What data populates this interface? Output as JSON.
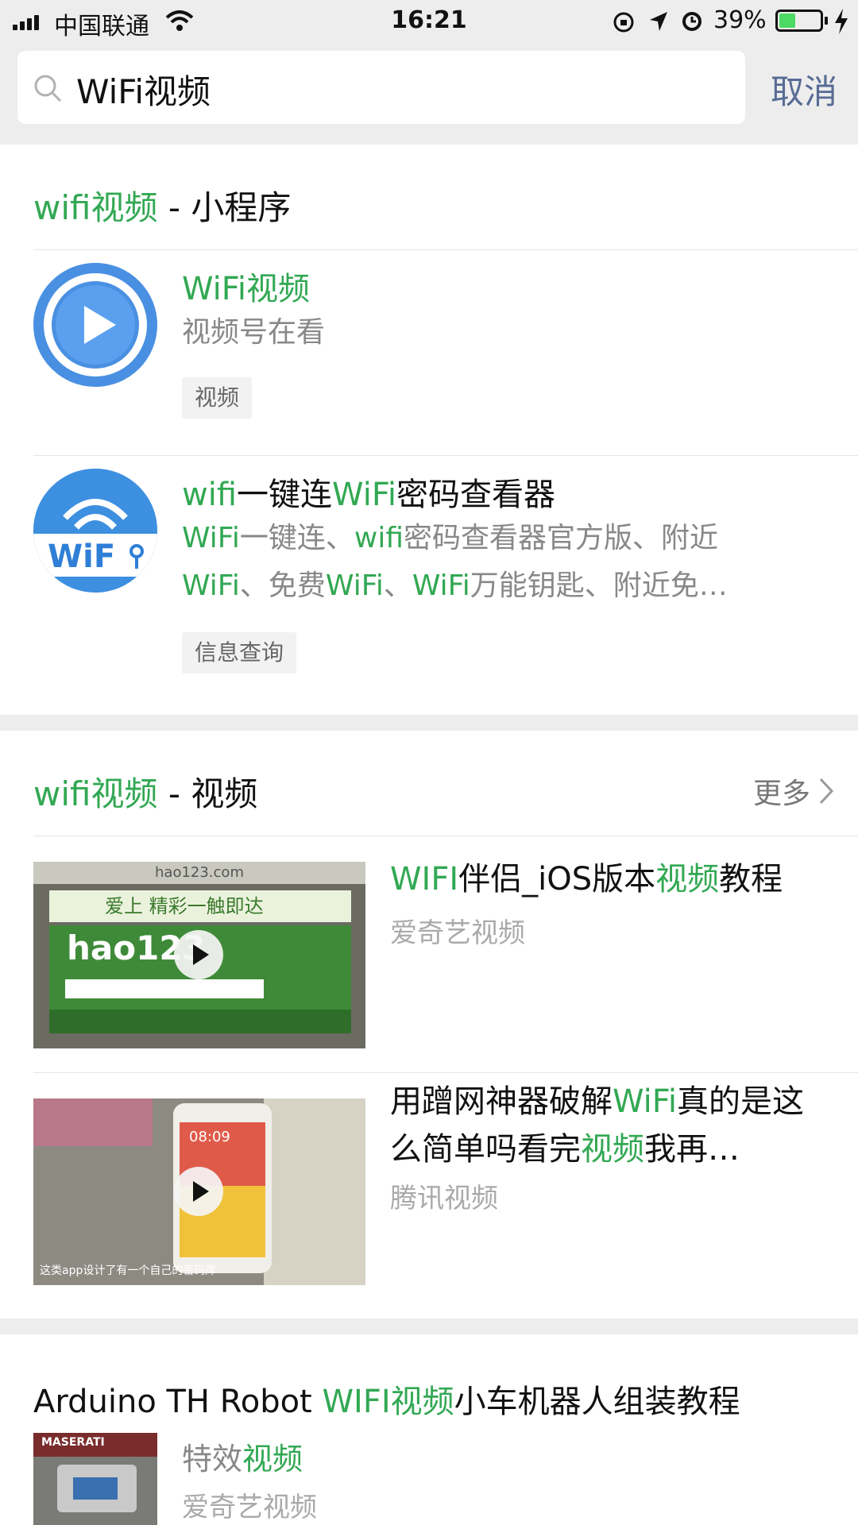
{
  "status_bar": {
    "carrier": "中国联通",
    "time": "16:21",
    "battery": "39%"
  },
  "search": {
    "query": "WiFi视频",
    "cancel_label": "取消"
  },
  "mini_program_section": {
    "title_highlight": "wifi视频",
    "title_rest": " - 小程序",
    "items": [
      {
        "title_parts": [
          {
            "text": "WiFi视频",
            "hl": true
          }
        ],
        "desc_lines": [
          [
            {
              "text": "视频号在看",
              "hl": false
            }
          ]
        ],
        "tag": "视频"
      },
      {
        "title_parts": [
          {
            "text": "wifi",
            "hl": true
          },
          {
            "text": "一键连",
            "hl": false
          },
          {
            "text": "WiFi",
            "hl": true
          },
          {
            "text": "密码查看器",
            "hl": false
          }
        ],
        "desc_lines": [
          [
            {
              "text": "WiFi",
              "hl": true
            },
            {
              "text": "一键连、",
              "hl": false
            },
            {
              "text": "wifi",
              "hl": true
            },
            {
              "text": "密码查看器官方版、附近",
              "hl": false
            }
          ],
          [
            {
              "text": "WiFi",
              "hl": true
            },
            {
              "text": "、免费",
              "hl": false
            },
            {
              "text": "WiFi",
              "hl": true
            },
            {
              "text": "、",
              "hl": false
            },
            {
              "text": "WiFi",
              "hl": true
            },
            {
              "text": "万能钥匙、附近免…",
              "hl": false
            }
          ]
        ],
        "tag": "信息查询",
        "icon_text": "WiF"
      }
    ]
  },
  "video_section": {
    "title_highlight": "wifi视频",
    "title_rest": " - 视频",
    "more_label": "更多",
    "items": [
      {
        "title_parts": [
          {
            "text": "WIFI",
            "hl": true
          },
          {
            "text": "伴侣_iOS版本",
            "hl": false
          },
          {
            "text": "视频",
            "hl": true
          },
          {
            "text": "教程",
            "hl": false
          }
        ],
        "source": "爱奇艺视频",
        "thumb_text_top": "hao123.com",
        "thumb_logo": "hao123",
        "thumb_banner": "爱上 精彩一触即达"
      },
      {
        "title_parts": [
          {
            "text": "用蹭网神器破解",
            "hl": false
          },
          {
            "text": "WiFi",
            "hl": true
          },
          {
            "text": "真的是这么简单吗看完",
            "hl": false
          },
          {
            "text": "视频",
            "hl": true
          },
          {
            "text": "我再…",
            "hl": false
          }
        ],
        "source": "腾讯视频",
        "thumb_time": "08:09",
        "thumb_caption": "这类app设计了有一个自己的密码库"
      }
    ]
  },
  "article": {
    "title_parts": [
      {
        "text": "Arduino TH Robot ",
        "hl": false
      },
      {
        "text": "WIFI视频",
        "hl": true
      },
      {
        "text": "小车机器人组装教程",
        "hl": false
      }
    ],
    "desc_parts": [
      {
        "text": "特效",
        "hl": false
      },
      {
        "text": "视频",
        "hl": true
      }
    ],
    "source": "爱奇艺视频",
    "thumb_brand": "MASERATI"
  },
  "colors": {
    "highlight": "#32a853",
    "link": "#576b95",
    "icon_blue": "#4a90e2"
  }
}
